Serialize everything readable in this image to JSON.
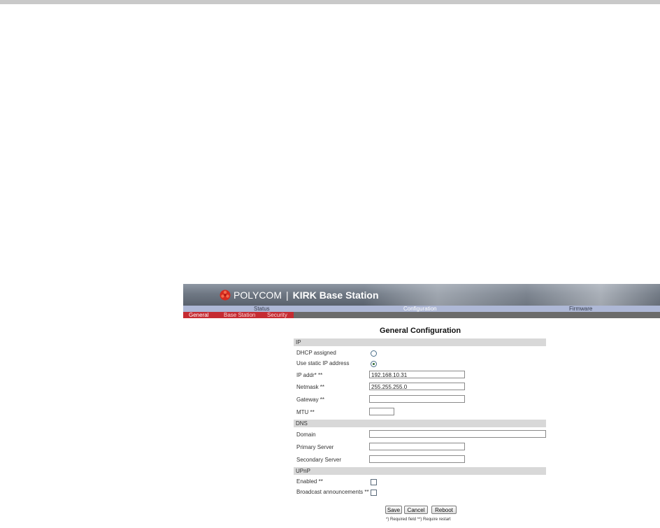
{
  "header": {
    "brand": "POLYCOM",
    "separator": "|",
    "product": "KIRK Base Station"
  },
  "nav": {
    "items": [
      {
        "label": "Status"
      },
      {
        "label": "Configuration",
        "active": true
      },
      {
        "label": "Firmware"
      }
    ]
  },
  "subnav": {
    "items": [
      {
        "label": "General",
        "active": true
      },
      {
        "label": "Base Station"
      },
      {
        "label": "Security"
      }
    ]
  },
  "page": {
    "title": "General Configuration"
  },
  "sections": {
    "ip": {
      "header": "IP",
      "dhcp_label": "DHCP assigned",
      "dhcp_selected": false,
      "static_label": "Use static IP address",
      "static_selected": true,
      "ip_label": "IP addr* **",
      "ip_value": "192.168.10.31",
      "netmask_label": "Netmask **",
      "netmask_value": "255.255.255.0",
      "gateway_label": "Gateway **",
      "gateway_value": "",
      "mtu_label": "MTU **",
      "mtu_value": ""
    },
    "dns": {
      "header": "DNS",
      "domain_label": "Domain",
      "domain_value": "",
      "primary_label": "Primary Server",
      "primary_value": "",
      "secondary_label": "Secondary Server",
      "secondary_value": ""
    },
    "upnp": {
      "header": "UPnP",
      "enabled_label": "Enabled **",
      "enabled_checked": false,
      "broadcast_label": "Broadcast announcements **",
      "broadcast_checked": false
    }
  },
  "buttons": {
    "save": "Save",
    "cancel": "Cancel",
    "reboot": "Reboot"
  },
  "footnote": "*) Required field **) Require restart",
  "colors": {
    "accent_red": "#c52b32",
    "nav_bg": "#aeb8d6",
    "banner_bg": "#6f7884"
  }
}
